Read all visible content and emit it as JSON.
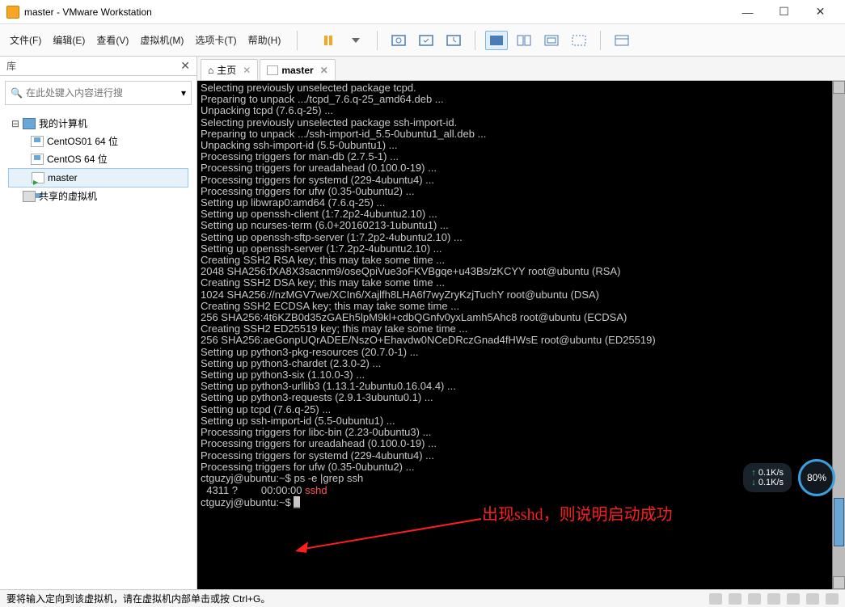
{
  "window": {
    "title": "master - VMware Workstation"
  },
  "win_controls": {
    "min": "—",
    "max": "☐",
    "close": "✕"
  },
  "menu": [
    "文件(F)",
    "编辑(E)",
    "查看(V)",
    "虚拟机(M)",
    "选项卡(T)",
    "帮助(H)"
  ],
  "sidebar": {
    "title": "库",
    "search_placeholder": "在此处键入内容进行搜",
    "nodes": {
      "root": "我的计算机",
      "vm1": "CentOS01 64 位",
      "vm2": "CentOS 64 位",
      "vm3": "master",
      "shared": "共享的虚拟机"
    }
  },
  "tabs": {
    "home": "主页",
    "master": "master"
  },
  "terminal": {
    "lines": [
      "Selecting previously unselected package tcpd.",
      "Preparing to unpack .../tcpd_7.6.q-25_amd64.deb ...",
      "Unpacking tcpd (7.6.q-25) ...",
      "Selecting previously unselected package ssh-import-id.",
      "Preparing to unpack .../ssh-import-id_5.5-0ubuntu1_all.deb ...",
      "Unpacking ssh-import-id (5.5-0ubuntu1) ...",
      "Processing triggers for man-db (2.7.5-1) ...",
      "Processing triggers for ureadahead (0.100.0-19) ...",
      "Processing triggers for systemd (229-4ubuntu4) ...",
      "Processing triggers for ufw (0.35-0ubuntu2) ...",
      "Setting up libwrap0:amd64 (7.6.q-25) ...",
      "Setting up openssh-client (1:7.2p2-4ubuntu2.10) ...",
      "Setting up ncurses-term (6.0+20160213-1ubuntu1) ...",
      "Setting up openssh-sftp-server (1:7.2p2-4ubuntu2.10) ...",
      "Setting up openssh-server (1:7.2p2-4ubuntu2.10) ...",
      "Creating SSH2 RSA key; this may take some time ...",
      "2048 SHA256:fXA8X3sacnm9/oseQpiVue3oFKVBgqe+u43Bs/zKCYY root@ubuntu (RSA)",
      "Creating SSH2 DSA key; this may take some time ...",
      "1024 SHA256://nzMGV7we/XCIn6/Xajlfh8LHA6f7wyZryKzjTuchY root@ubuntu (DSA)",
      "Creating SSH2 ECDSA key; this may take some time ...",
      "256 SHA256:4t6KZB0d35zGAEh5lpM9kl+cdbQGnfv0yxLamh5Ahc8 root@ubuntu (ECDSA)",
      "Creating SSH2 ED25519 key; this may take some time ...",
      "256 SHA256:aeGonpUQrADEE/NszO+Ehavdw0NCeDRczGnad4fHWsE root@ubuntu (ED25519)",
      "Setting up python3-pkg-resources (20.7.0-1) ...",
      "Setting up python3-chardet (2.3.0-2) ...",
      "Setting up python3-six (1.10.0-3) ...",
      "Setting up python3-urllib3 (1.13.1-2ubuntu0.16.04.4) ...",
      "Setting up python3-requests (2.9.1-3ubuntu0.1) ...",
      "Setting up tcpd (7.6.q-25) ...",
      "Setting up ssh-import-id (5.5-0ubuntu1) ...",
      "Processing triggers for libc-bin (2.23-0ubuntu3) ...",
      "Processing triggers for ureadahead (0.100.0-19) ...",
      "Processing triggers for systemd (229-4ubuntu4) ...",
      "Processing triggers for ufw (0.35-0ubuntu2) ..."
    ],
    "prompt1": "ctguzyj@ubuntu:~$ ",
    "cmd1": "ps -e |grep ssh",
    "out_pid": "  4311 ?        00:00:00 ",
    "out_proc": "sshd",
    "prompt2": "ctguzyj@ubuntu:~$ ",
    "cursor": "_"
  },
  "annotation": "出现sshd，则说明启动成功",
  "net": {
    "up": "0.1K/s",
    "down": "0.1K/s",
    "pct": "80%"
  },
  "status": "要将输入定向到该虚拟机，请在虚拟机内部单击或按 Ctrl+G。"
}
